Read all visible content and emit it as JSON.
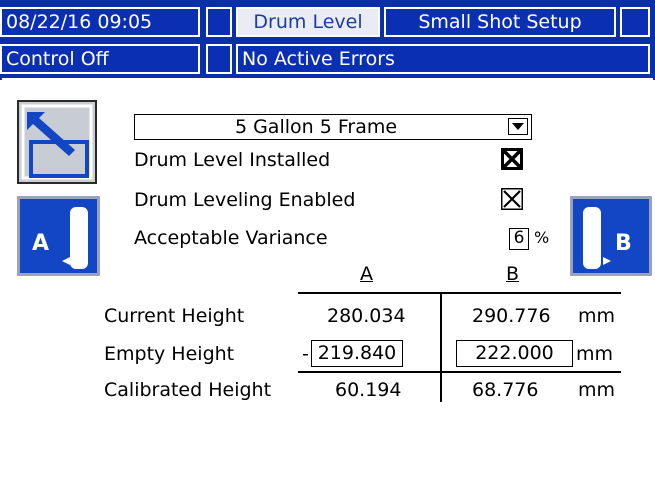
{
  "header": {
    "datetime": "08/22/16 09:05",
    "tab_active": "Drum Level",
    "tab_next": "Small Shot Setup",
    "status": "Control Off",
    "errors": "No Active Errors"
  },
  "settings": {
    "selection": "5 Gallon 5 Frame",
    "drum_level_installed_label": "Drum Level Installed",
    "drum_level_installed": true,
    "drum_leveling_enabled_label": "Drum Leveling Enabled",
    "drum_leveling_enabled": true,
    "variance_label": "Acceptable Variance",
    "variance_value": "6",
    "variance_unit": "%"
  },
  "table": {
    "col_a": "A",
    "col_b": "B",
    "rows": [
      {
        "label": "Current Height",
        "a": "280.034",
        "b": "290.776",
        "unit": "mm"
      },
      {
        "label": "Empty Height",
        "prefix": "-",
        "a": "219.840",
        "b": "222.000",
        "unit": "mm"
      },
      {
        "label": "Calibrated Height",
        "a": "60.194",
        "b": "68.776",
        "unit": "mm"
      }
    ]
  },
  "buttons": {
    "left_label": "A",
    "right_label": "B"
  },
  "colors": {
    "header_blue": "#0b2fb3",
    "icon_blue": "#1346c4",
    "frame_gray": "#c8ccd4"
  }
}
